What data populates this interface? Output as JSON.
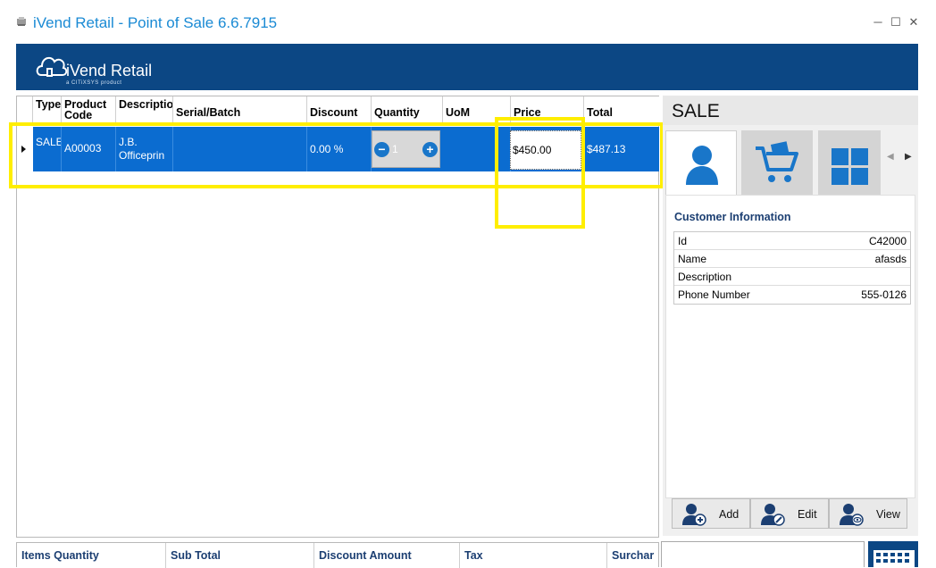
{
  "window": {
    "title": "iVend Retail - Point of Sale 6.6.7915",
    "minimize": "─",
    "maximize": "☐",
    "close": "✕"
  },
  "banner": {
    "logo_text": "iVend Retail",
    "logo_sub": "a CITiXSYS product",
    "color": "#0c4784"
  },
  "grid": {
    "columns": [
      "Type",
      "Product Code",
      "Description",
      "Serial/Batch",
      "Discount",
      "Quantity",
      "UoM",
      "Price",
      "Total"
    ],
    "rows": [
      {
        "type": "SALE",
        "product_code": "A00003",
        "description": "J.B. Officeprin",
        "serial_batch": "",
        "discount": "0.00 %",
        "quantity": "1",
        "uom": "",
        "price": "$450.00",
        "total": "$487.13"
      }
    ],
    "selection_color": "#0b6cd0"
  },
  "sale_panel": {
    "title": "SALE",
    "tabs": [
      {
        "name": "customer",
        "icon": "customer-icon",
        "active": true
      },
      {
        "name": "cart",
        "icon": "shopping-cart-icon",
        "active": false
      },
      {
        "name": "apps",
        "icon": "grid-tiles-icon",
        "active": false
      }
    ],
    "nav_prev": "◀",
    "nav_next": "▶",
    "customer_info": {
      "title": "Customer Information",
      "fields": [
        {
          "label": "Id",
          "value": "C42000"
        },
        {
          "label": "Name",
          "value": "afasds"
        },
        {
          "label": "Description",
          "value": ""
        },
        {
          "label": "Phone Number",
          "value": "555-0126"
        }
      ]
    },
    "actions": [
      {
        "label": "Add",
        "icon": "add-customer-icon"
      },
      {
        "label": "Edit",
        "icon": "edit-customer-icon"
      },
      {
        "label": "View",
        "icon": "view-customer-icon"
      }
    ]
  },
  "summary": {
    "items_quantity_label": "Items Quantity",
    "sub_total_label": "Sub Total",
    "discount_amount_label": "Discount Amount",
    "tax_label": "Tax",
    "surcharge_label": "Surchar"
  },
  "accent_color": "#1976c9",
  "highlight_color": "#ffee00"
}
